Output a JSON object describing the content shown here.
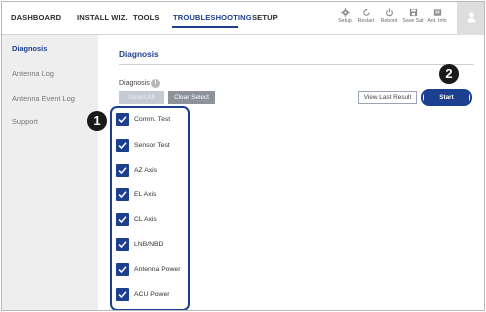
{
  "nav": {
    "tabs": [
      {
        "label": "DASHBOARD"
      },
      {
        "label": "INSTALL WIZ."
      },
      {
        "label": "TOOLS"
      },
      {
        "label": "TROUBLESHOOTING",
        "active": true
      },
      {
        "label": "SETUP"
      }
    ],
    "tools": [
      {
        "label": "Setup",
        "icon": "gear-icon"
      },
      {
        "label": "Restart",
        "icon": "restart-icon"
      },
      {
        "label": "Reboot",
        "icon": "power-icon"
      },
      {
        "label": "Save Sat",
        "icon": "save-icon"
      },
      {
        "label": "Ant. Info",
        "icon": "info-card-icon"
      }
    ],
    "user_icon": "user-icon"
  },
  "sidebar": {
    "items": [
      {
        "label": "Diagnosis",
        "active": true
      },
      {
        "label": "Antenna Log"
      },
      {
        "label": "Antenna Event Log"
      },
      {
        "label": "Support"
      }
    ]
  },
  "main": {
    "title": "Diagnosis",
    "section_label": "Diagnosis",
    "info_glyph": "i",
    "buttons": {
      "select_all": "Select All",
      "clear_select": "Clear Select",
      "view_last_result": "View Last Result",
      "start": "Start"
    },
    "checks": [
      {
        "label": "Comm. Test",
        "checked": true
      },
      {
        "label": "Sensor Test",
        "checked": true
      },
      {
        "label": "AZ Axis",
        "checked": true
      },
      {
        "label": "EL Axis",
        "checked": true
      },
      {
        "label": "CL Axis",
        "checked": true
      },
      {
        "label": "LNB/NBD",
        "checked": true
      },
      {
        "label": "Antenna Power",
        "checked": true
      },
      {
        "label": "ACU Power",
        "checked": true
      }
    ]
  },
  "callouts": {
    "one": "1",
    "two": "2"
  },
  "colors": {
    "accent": "#1c3f8f",
    "sidebar_bg": "#eeeeee",
    "clear_button": "#8e939b",
    "select_all_button": "#c5cad3",
    "callout_badge": "#1a1a1a"
  }
}
